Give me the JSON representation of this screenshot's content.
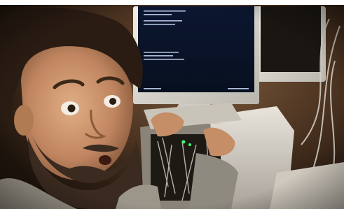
{
  "photo": {
    "subject": "man-with-beard-at-computer",
    "monitor_screen": {
      "foreground": "#cfe0ff"
    },
    "palette": {
      "shadow": "#1a120c",
      "warm_wall": "#6b4a2c",
      "skin": "#c9946b",
      "beard": "#3a2a1f",
      "hair": "#2a1c13",
      "monitor_bezel": "#d8d8d2",
      "screen": "#0a1226",
      "pc_case": "#d9d5cc"
    }
  }
}
